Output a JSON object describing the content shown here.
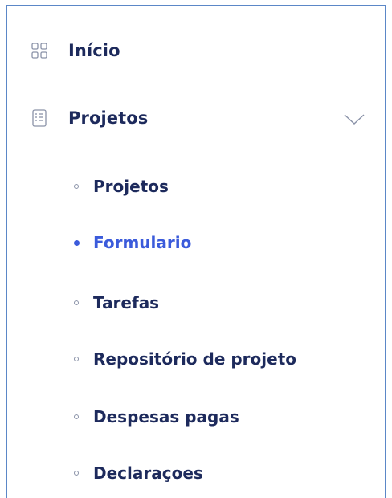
{
  "menu": {
    "inicio": {
      "label": "Início",
      "icon": "grid-icon"
    },
    "projetos": {
      "label": "Projetos",
      "icon": "document-list-icon",
      "expanded": true
    },
    "submenu": [
      {
        "label": "Projetos",
        "active": false
      },
      {
        "label": "Formulario",
        "active": true
      },
      {
        "label": "Tarefas",
        "active": false
      },
      {
        "label": "Repositório de projeto",
        "active": false
      },
      {
        "label": "Despesas pagas",
        "active": false
      },
      {
        "label": "Declaraçoes",
        "active": false
      }
    ]
  },
  "colors": {
    "text": "#1d2a5c",
    "active": "#3b5bdb",
    "border": "#5b87c7",
    "icon": "#8a92a8"
  }
}
